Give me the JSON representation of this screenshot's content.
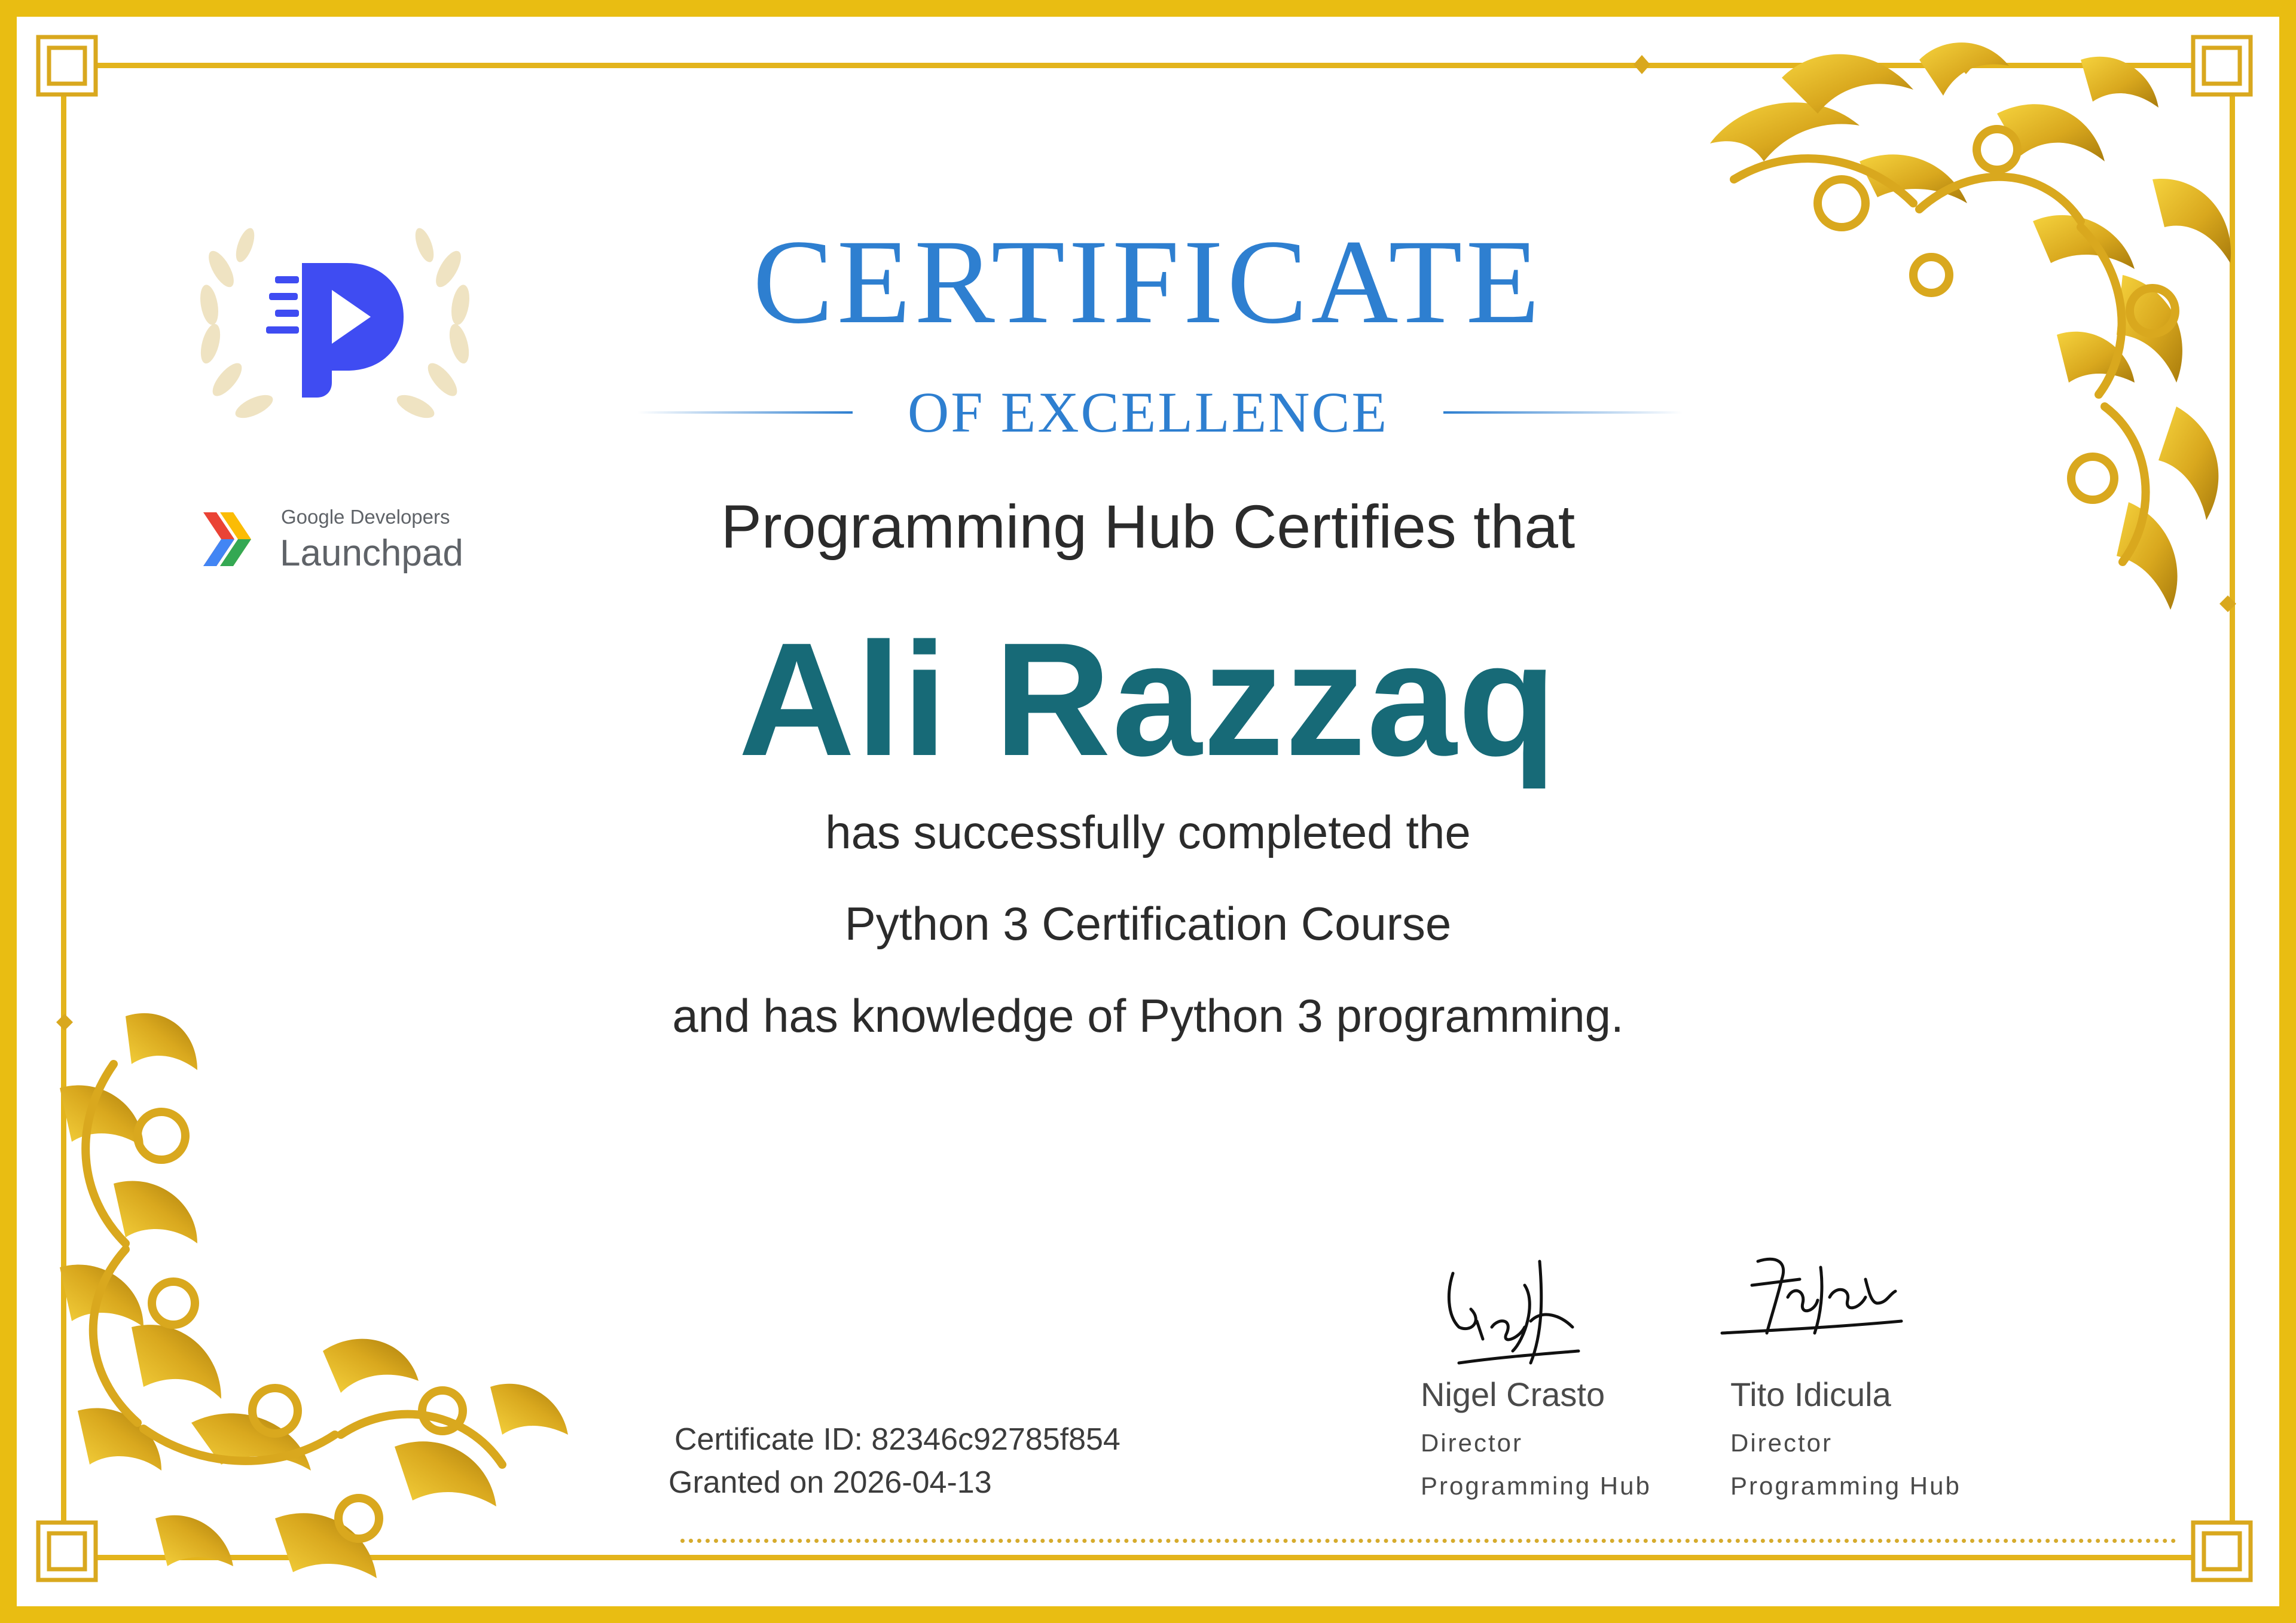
{
  "certificate": {
    "title": "CERTIFICATE",
    "subtitle": "OF EXCELLENCE",
    "certifier_line": "Programming Hub Certifies that",
    "recipient_name": "Ali Razzaq",
    "body_line_1": "has successfully completed the",
    "body_line_2": "Python 3 Certification Course",
    "body_line_3": "and has knowledge of Python 3 programming.",
    "certificate_id": "Certificate ID: 82346c92785f854",
    "granted_on": "Granted on 2026-04-13"
  },
  "logos": {
    "programming_hub_icon": "p-play-logo-in-laurel-wreath",
    "launchpad_small": "Google Developers",
    "launchpad_big": "Launchpad"
  },
  "signatories": [
    {
      "name": "Nigel Crasto",
      "role": "Director",
      "org": "Programming Hub"
    },
    {
      "name": "Tito Idicula",
      "role": "Director",
      "org": "Programming Hub"
    }
  ],
  "colors": {
    "gold": "#e3b41c",
    "gold_dark": "#b8860b",
    "title_blue": "#2e7fd0",
    "name_teal": "#176a77",
    "text_dark": "#2b2b2b",
    "hub_blue": "#3f4cf2",
    "laurel": "#efe3c2"
  }
}
